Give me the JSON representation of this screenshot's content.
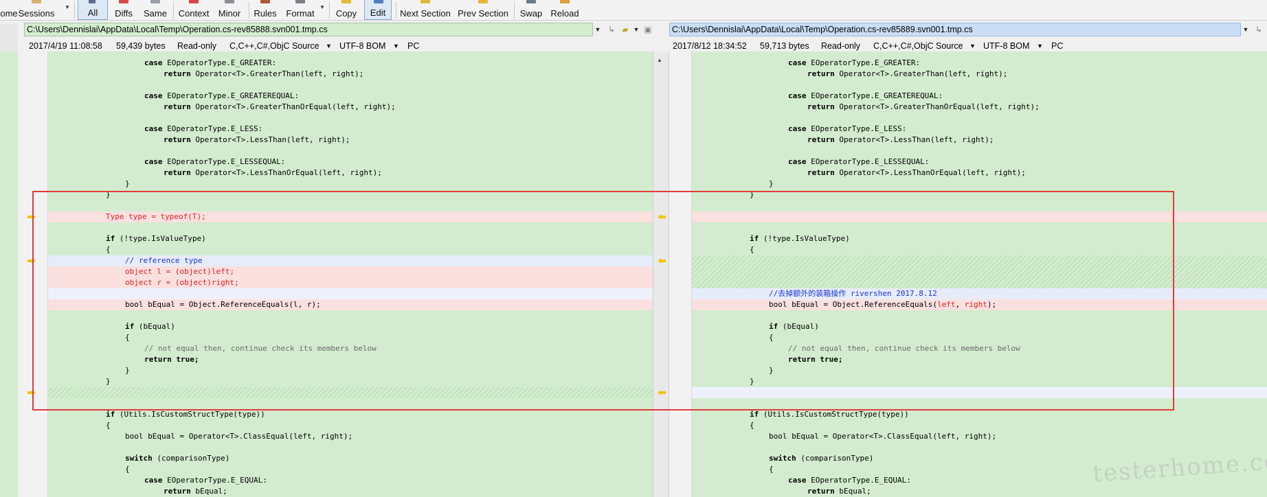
{
  "toolbar": {
    "home": "ome",
    "sessions": "Sessions",
    "all": "All",
    "diffs": "Diffs",
    "same": "Same",
    "context": "Context",
    "minor": "Minor",
    "rules": "Rules",
    "format": "Format",
    "copy": "Copy",
    "edit": "Edit",
    "next_section": "Next Section",
    "prev_section": "Prev Section",
    "swap": "Swap",
    "reload": "Reload"
  },
  "left": {
    "path": "C:\\Users\\Dennislai\\AppData\\Local\\Temp\\Operation.cs-rev85888.svn001.tmp.cs",
    "date": "2017/4/19 11:08:58",
    "size": "59,439 bytes",
    "mode": "Read-only",
    "format": "C,C++,C#,ObjC Source",
    "encoding": "UTF-8 BOM",
    "lineend": "PC"
  },
  "right": {
    "path": "C:\\Users\\Dennislai\\AppData\\Local\\Temp\\Operation.cs-rev85889.svn001.tmp.cs",
    "date": "2017/8/12 18:34:52",
    "size": "59,713 bytes",
    "mode": "Read-only",
    "format": "C,C++,C#,ObjC Source",
    "encoding": "UTF-8 BOM",
    "lineend": "PC"
  },
  "code": {
    "l1_case": "case",
    "l1_rest": " EOperatorType.E_GREATER:",
    "l2_ret": "return",
    "l2_rest": " Operator<T>.GreaterThan(left, right);",
    "l3_rest": " EOperatorType.E_GREATEREQUAL:",
    "l4_rest": " Operator<T>.GreaterThanOrEqual(left, right);",
    "l5_rest": " EOperatorType.E_LESS:",
    "l6_rest": " Operator<T>.LessThan(left, right);",
    "l7_rest": " EOperatorType.E_LESSEQUAL:",
    "l8_rest": " Operator<T>.LessThanOrEqual(left, right);",
    "close_brace": "}",
    "open_brace": "{",
    "type_line": "Type type = typeof(T);",
    "if_kw": "if",
    "if_value": " (!type.IsValueType)",
    "cmt_ref": "// reference type",
    "obj_l": "object l = (object)left;",
    "obj_r": "object r = (object)right;",
    "bool_left": "bool bEqual = Object.ReferenceEquals(l, r);",
    "bool_right_a": "bool bEqual = Object.ReferenceEquals(",
    "bool_right_left": "left",
    "bool_right_sep": ", ",
    "bool_right_right": "right",
    "bool_right_end": ");",
    "cn_comment": "//去掉额外的装箱操作 rivershen 2017.8.12",
    "if_bequal": " (bEqual)",
    "cmt_not_equal": "// not equal then, continue check its members below",
    "ret_true_kw": "return",
    "ret_true": " true;",
    "if_custom": " (Utils.IsCustomStructType(type))",
    "bool_class": "bool bEqual = Operator<T>.ClassEqual(left, right);",
    "switch_kw": "switch",
    "switch_rest": " (comparisonType)",
    "case_equal": " EOperatorType.E_EQUAL:",
    "ret_bequal": " bEqual;"
  },
  "watermark": "testerhome.com",
  "colors": {
    "same_bg": "#d3eccf",
    "diff_bg": "#fbe0e0",
    "highlight": "#e23a3a",
    "diff_text": "#e1201f"
  }
}
